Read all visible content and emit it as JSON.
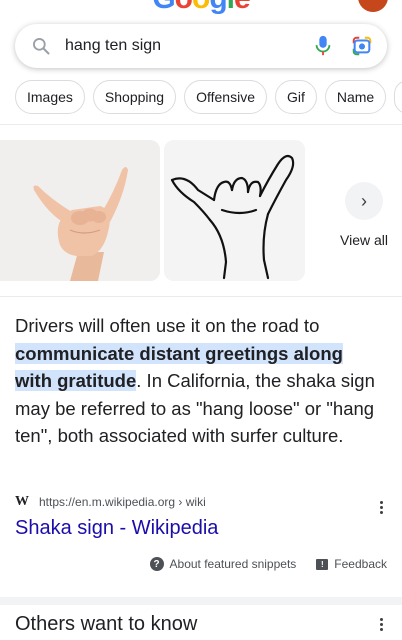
{
  "logo": {
    "text": "Google"
  },
  "search": {
    "query": "hang ten sign"
  },
  "chips": [
    "Images",
    "Shopping",
    "Offensive",
    "Gif",
    "Name",
    "I"
  ],
  "carousel": {
    "view_all": "View all"
  },
  "snippet": {
    "text_before": "Drivers will often use it on the road to ",
    "highlight": "communicate distant greetings along with gratitude",
    "text_after": ". In California, the shaka sign may be referred to as \"hang loose\" or \"hang ten\", both associated with surfer culture."
  },
  "source": {
    "logo_letter": "W",
    "url": "https://en.m.wikipedia.org › wiki",
    "title": "Shaka sign - Wikipedia"
  },
  "footer": {
    "about": "About featured snippets",
    "feedback": "Feedback"
  },
  "others": {
    "title": "Others want to know"
  },
  "colors": {
    "link": "#1a0dab",
    "highlight": "#d2e3fc",
    "mic_blue": "#4285f4",
    "avatar": "#c5471b"
  },
  "icons": {
    "search": "search-icon",
    "mic": "microphone-icon",
    "lens": "google-lens-icon",
    "chevron": "chevron-right-icon",
    "more": "more-vert-icon",
    "help": "help-circle-icon",
    "feedback": "feedback-icon"
  }
}
